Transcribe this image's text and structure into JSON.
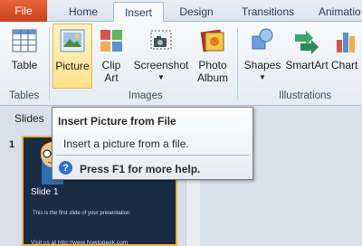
{
  "tabs": {
    "file": "File",
    "home": "Home",
    "insert": "Insert",
    "design": "Design",
    "transitions": "Transitions",
    "animations": "Animatio"
  },
  "ribbon": {
    "table": "Table",
    "picture": "Picture",
    "clip_art_line1": "Clip",
    "clip_art_line2": "Art",
    "screenshot": "Screenshot",
    "photo_album_line1": "Photo",
    "photo_album_line2": "Album",
    "shapes": "Shapes",
    "smartart": "SmartArt",
    "chart": "Chart",
    "groups": {
      "tables": "Tables",
      "images": "Images",
      "illustrations": "Illustrations"
    }
  },
  "slides_panel": {
    "label": "Slides",
    "slide_number": "1",
    "thumb_title": "Slide 1",
    "thumb_body": "This is the first slide of your presentation",
    "thumb_footer": "Visit us at http://www.howtogeek.com"
  },
  "tooltip": {
    "title": "Insert Picture from File",
    "description": "Insert a picture from a file.",
    "help": "Press F1 for more help.",
    "help_icon": "?"
  },
  "colors": {
    "file_tab": "#d9522a",
    "selected_button": "#ffe28a",
    "help_icon": "#2e6fcf"
  }
}
